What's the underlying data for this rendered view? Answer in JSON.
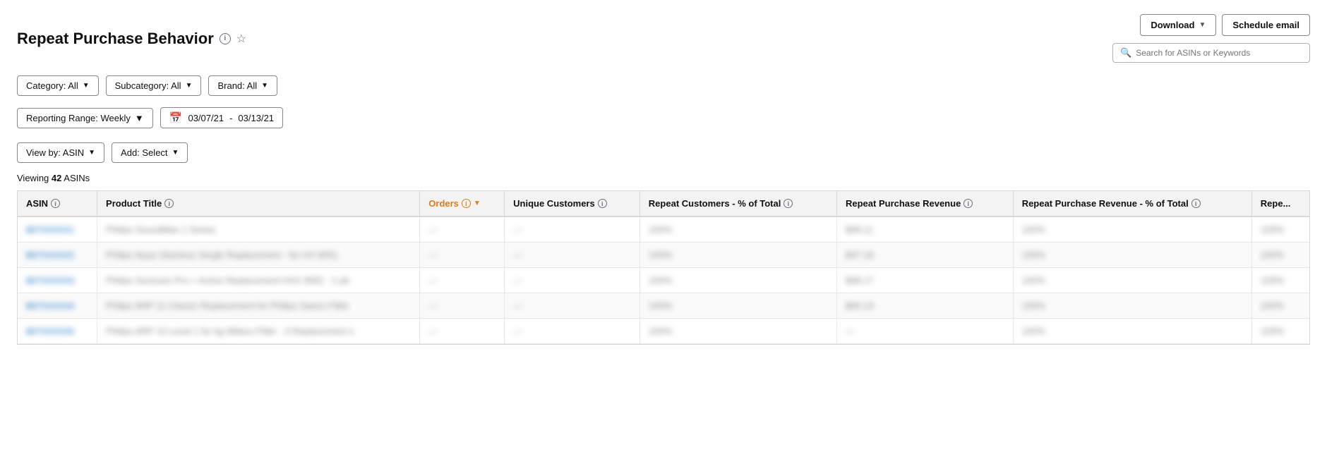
{
  "page": {
    "title": "Repeat Purchase Behavior",
    "viewing_text": "Viewing",
    "viewing_count": "42",
    "viewing_unit": "ASINs"
  },
  "header": {
    "download_label": "Download",
    "schedule_email_label": "Schedule email",
    "search_placeholder": "Search for ASINs or Keywords"
  },
  "filters": {
    "category_label": "Category: All",
    "subcategory_label": "Subcategory: All",
    "brand_label": "Brand: All",
    "reporting_range_label": "Reporting Range: Weekly",
    "date_from": "03/07/21",
    "date_separator": "-",
    "date_to": "03/13/21",
    "view_by_label": "View by: ASIN",
    "add_label": "Add: Select"
  },
  "table": {
    "columns": [
      {
        "id": "asin",
        "label": "ASIN",
        "has_info": true,
        "is_orders": false
      },
      {
        "id": "product_title",
        "label": "Product Title",
        "has_info": true,
        "is_orders": false
      },
      {
        "id": "orders",
        "label": "Orders",
        "has_info": true,
        "is_orders": true,
        "sortable": true
      },
      {
        "id": "unique_customers",
        "label": "Unique Customers",
        "has_info": true,
        "is_orders": false
      },
      {
        "id": "repeat_customers_pct",
        "label": "Repeat Customers - % of Total",
        "has_info": true,
        "is_orders": false
      },
      {
        "id": "repeat_purchase_revenue",
        "label": "Repeat Purchase Revenue",
        "has_info": true,
        "is_orders": false
      },
      {
        "id": "repeat_purchase_revenue_pct",
        "label": "Repeat Purchase Revenue - % of Total",
        "has_info": true,
        "is_orders": false
      },
      {
        "id": "repe",
        "label": "Repe...",
        "has_info": false,
        "is_orders": false
      }
    ],
    "rows": [
      {
        "asin": "B07XXXXX1",
        "product_title": "Philips SoundMax 1 Series",
        "orders": "—",
        "unique_customers": "—",
        "repeat_customers_pct": "100%",
        "repeat_purchase_revenue": "$99.11",
        "repeat_purchase_revenue_pct": "100%",
        "repe": "100%"
      },
      {
        "asin": "B07XXXXX2",
        "product_title": "Philips Aqua Stainless Single Replacement - for HX 8051",
        "orders": "—",
        "unique_customers": "—",
        "repeat_customers_pct": "100%",
        "repeat_purchase_revenue": "$47.18",
        "repeat_purchase_revenue_pct": "100%",
        "repe": "100%"
      },
      {
        "asin": "B07XXXXX3",
        "product_title": "Philips Sonicare Pro + Active Replacement HX4 3082 - 1 pk.",
        "orders": "—",
        "unique_customers": "—",
        "repeat_customers_pct": "100%",
        "repeat_purchase_revenue": "$98.17",
        "repeat_purchase_revenue_pct": "100%",
        "repe": "100%"
      },
      {
        "asin": "B07XXXXX4",
        "product_title": "Philips ARP 11 Classic Replacement for Philips Saeco Filter",
        "orders": "—",
        "unique_customers": "—",
        "repeat_customers_pct": "100%",
        "repeat_purchase_revenue": "$66.13",
        "repeat_purchase_revenue_pct": "100%",
        "repe": "100%"
      },
      {
        "asin": "B07XXXXX5",
        "product_title": "Philips ARP 13 Level 1 for kg Milano Filter - 3 Replacement s",
        "orders": "—",
        "unique_customers": "—",
        "repeat_customers_pct": "100%",
        "repeat_purchase_revenue": "—",
        "repeat_purchase_revenue_pct": "100%",
        "repe": "100%"
      }
    ]
  }
}
